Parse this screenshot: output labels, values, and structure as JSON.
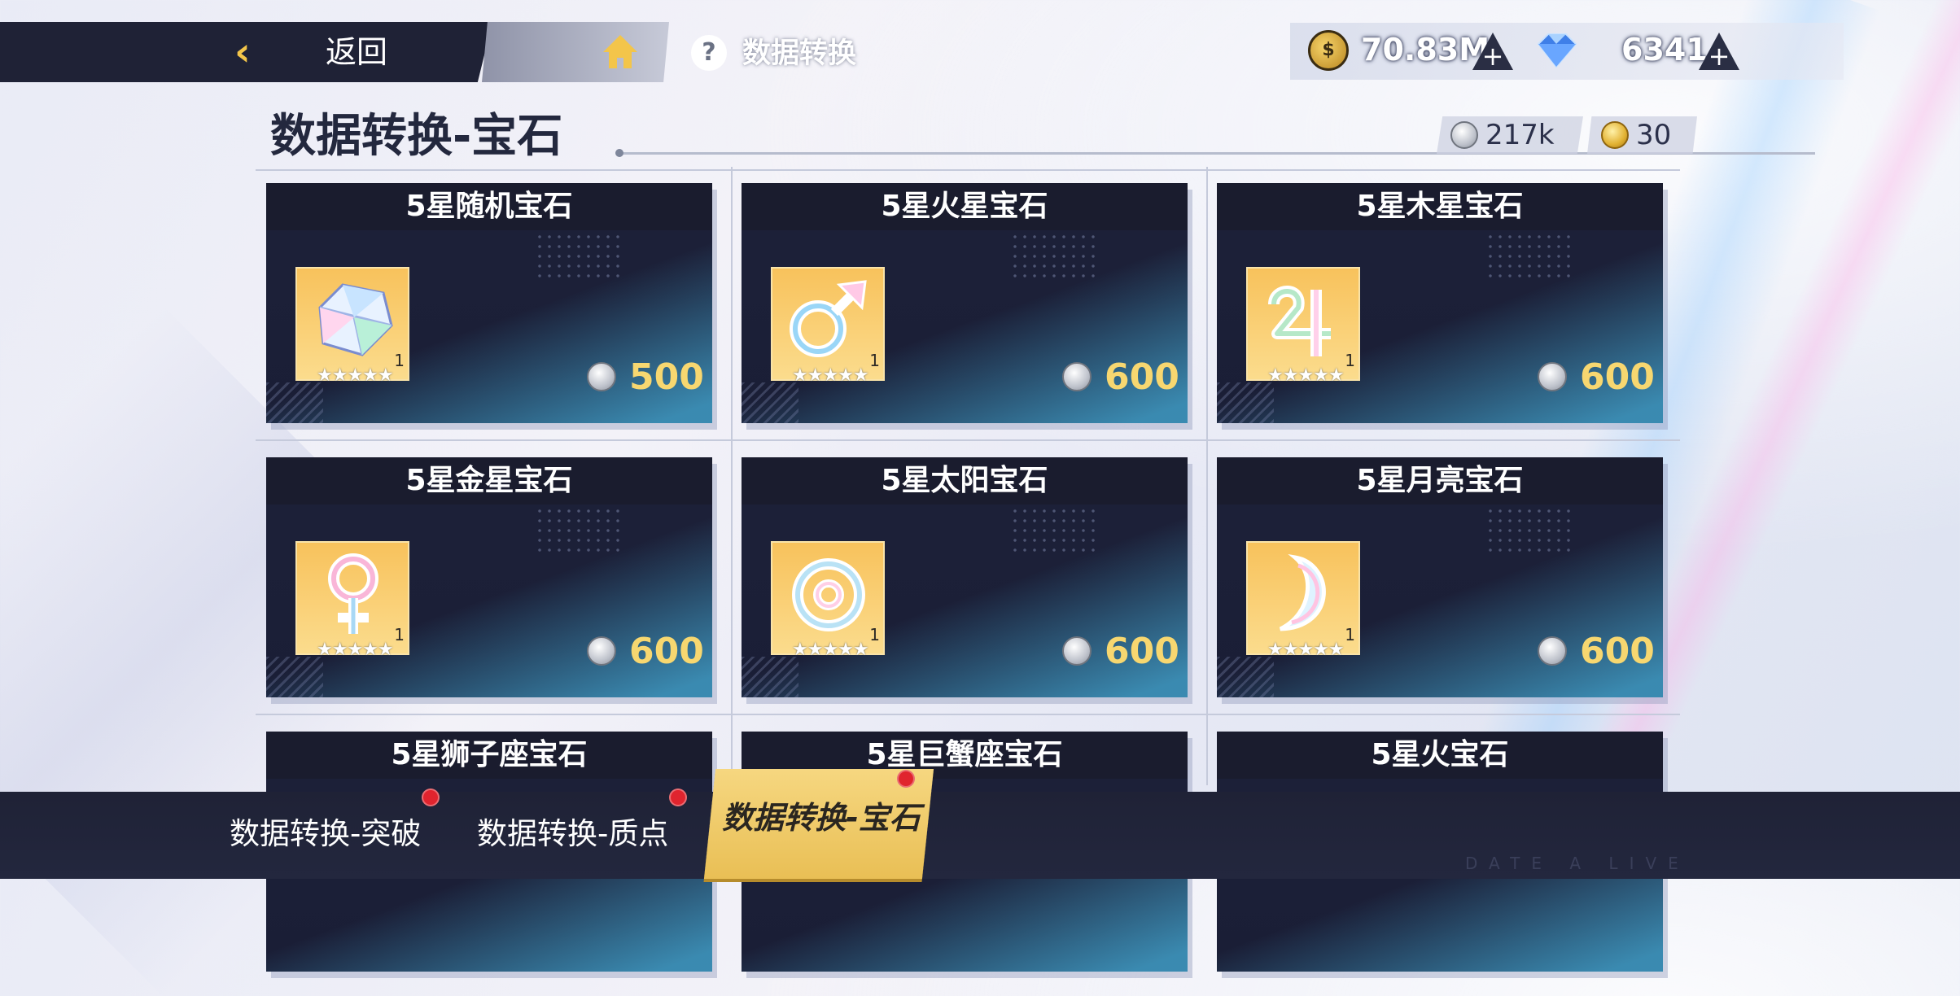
{
  "header": {
    "back_label": "返回",
    "help_label": "数据转换",
    "help_glyph": "?",
    "coin_glyph": "$"
  },
  "resources": {
    "gold": "70.83M",
    "crystals": "6341"
  },
  "page": {
    "title": "数据转换-宝石",
    "silver_balance": "217k",
    "gold_balance": "30"
  },
  "cards": [
    {
      "title": "5星随机宝石",
      "count": "1",
      "price": "500",
      "stars": "★★★★★",
      "icon": "crystal-gem-icon"
    },
    {
      "title": "5星火星宝石",
      "count": "1",
      "price": "600",
      "stars": "★★★★★",
      "icon": "mars-symbol-icon"
    },
    {
      "title": "5星木星宝石",
      "count": "1",
      "price": "600",
      "stars": "★★★★★",
      "icon": "jupiter-symbol-icon"
    },
    {
      "title": "5星金星宝石",
      "count": "1",
      "price": "600",
      "stars": "★★★★★",
      "icon": "venus-symbol-icon"
    },
    {
      "title": "5星太阳宝石",
      "count": "1",
      "price": "600",
      "stars": "★★★★★",
      "icon": "sun-symbol-icon"
    },
    {
      "title": "5星月亮宝石",
      "count": "1",
      "price": "600",
      "stars": "★★★★★",
      "icon": "moon-symbol-icon"
    },
    {
      "title": "5星狮子座宝石"
    },
    {
      "title": "5星巨蟹座宝石"
    },
    {
      "title": "5星火宝石"
    }
  ],
  "tabs": [
    {
      "label": "数据转换-突破",
      "has_badge": true
    },
    {
      "label": "数据转换-质点",
      "has_badge": true
    },
    {
      "label": "数据转换-宝石",
      "has_badge": true,
      "active": true
    }
  ],
  "watermark": "DATE A LIVE",
  "colors": {
    "accent_gold": "#f7d770",
    "tab_active": "#f6d780",
    "dark_panel": "#1f2236",
    "badge_red": "#e0242e"
  }
}
